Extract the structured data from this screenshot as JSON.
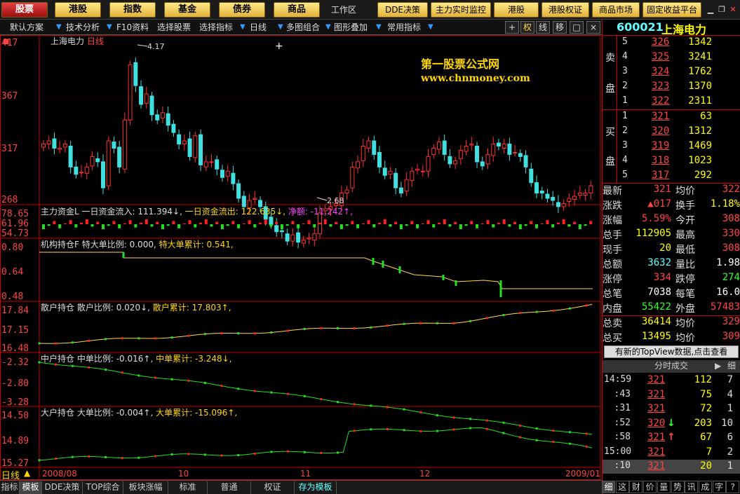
{
  "nav": {
    "main": [
      "股票",
      "港股",
      "指数",
      "基金",
      "债券",
      "商品"
    ],
    "workspace": "工作区",
    "secondary": [
      "DDE决策",
      "主力实时监控",
      "港股",
      "港股权证",
      "商品市场",
      "固定收益平台"
    ]
  },
  "toolbar": {
    "items": [
      "默认方案",
      "技术分析",
      "F10资料",
      "选择股票",
      "选择指标",
      "日线",
      "多图组合",
      "图形叠加",
      "常用指标"
    ],
    "buttons": [
      "+",
      "权",
      "线",
      "移",
      "□",
      "×"
    ]
  },
  "stock": {
    "code": "600021",
    "name": "上海电力"
  },
  "panes": {
    "main": {
      "title": "上海电力",
      "period": "日线",
      "y_labels": [
        "417",
        "367",
        "317",
        "268"
      ],
      "high": "4.17",
      "low": "2.68"
    },
    "watermark": {
      "line1": "第一股票公式网",
      "line2": "www.chnmoney.com"
    },
    "fund": {
      "label": "主力资金L",
      "inflow_label": "一日资金流入:",
      "inflow": "111.394",
      "outflow_label": "一日资金流出:",
      "outflow": "122.635",
      "net_label": "净额:",
      "net": "-11.242",
      "y_labels": [
        "78.65",
        "61.96",
        "54.73"
      ]
    },
    "inst": {
      "label": "机构持仓F",
      "ratio_label": "特大单比例:",
      "ratio": "0.000,",
      "cum_label": "特大单累计:",
      "cum": "0.541,",
      "y_labels": [
        "0.80",
        "0.64",
        "0.48"
      ]
    },
    "retail": {
      "label": "散户持仓",
      "ratio_label": "散户比例:",
      "ratio": "0.020",
      "cum_label": "散户累计:",
      "cum": "17.803",
      "y_labels": [
        "17.84",
        "17.15",
        "16.48"
      ]
    },
    "mid": {
      "label": "中户持仓",
      "ratio_label": "中单比例:",
      "ratio": "-0.016",
      "cum_label": "中单累计:",
      "cum": "-3.248",
      "y_labels": [
        "-2.32",
        "-2.80",
        "-3.28"
      ]
    },
    "big": {
      "label": "大户持仓",
      "ratio_label": "大单比例:",
      "ratio": "-0.004",
      "cum_label": "大单累计:",
      "cum": "-15.096",
      "y_labels": [
        "14.50",
        "14.89",
        "15.27"
      ]
    },
    "xaxis": {
      "period": "日线",
      "ticks": [
        "2008/08",
        "10",
        "11",
        "12",
        "2009/01"
      ]
    }
  },
  "orderbook": {
    "sell_label": [
      "卖",
      "盘"
    ],
    "buy_label": [
      "买",
      "盘"
    ],
    "sell": [
      {
        "lvl": "5",
        "price": "326",
        "vol": "1342"
      },
      {
        "lvl": "4",
        "price": "325",
        "vol": "3241"
      },
      {
        "lvl": "3",
        "price": "324",
        "vol": "1762"
      },
      {
        "lvl": "2",
        "price": "323",
        "vol": "1370"
      },
      {
        "lvl": "1",
        "price": "322",
        "vol": "2311"
      }
    ],
    "buy": [
      {
        "lvl": "1",
        "price": "321",
        "vol": "63"
      },
      {
        "lvl": "2",
        "price": "320",
        "vol": "1312"
      },
      {
        "lvl": "3",
        "price": "319",
        "vol": "1469"
      },
      {
        "lvl": "4",
        "price": "318",
        "vol": "1023"
      },
      {
        "lvl": "5",
        "price": "317",
        "vol": "292"
      }
    ]
  },
  "quote": [
    {
      "k1": "最新",
      "v1": "321",
      "c1": "#ff4444",
      "k2": "均价",
      "v2": "322",
      "c2": "#ff4444"
    },
    {
      "k1": "涨跌",
      "v1": "▲017",
      "c1": "#ff4444",
      "k2": "换手",
      "v2": "1.18%",
      "c2": "#ffff00"
    },
    {
      "k1": "涨幅",
      "v1": "5.59%",
      "c1": "#ff4444",
      "k2": "今开",
      "v2": "308",
      "c2": "#ff4444"
    },
    {
      "k1": "总手",
      "v1": "112905",
      "c1": "#ffff00",
      "k2": "最高",
      "v2": "330",
      "c2": "#ff4444"
    },
    {
      "k1": "现手",
      "v1": "20",
      "c1": "#ffff00",
      "k2": "最低",
      "v2": "308",
      "c2": "#ff4444"
    },
    {
      "k1": "总额",
      "v1": "3632",
      "c1": "#66ffff",
      "k2": "量比",
      "v2": "1.98",
      "c2": "#ffffff"
    },
    {
      "k1": "涨停",
      "v1": "334",
      "c1": "#ff4444",
      "k2": "跌停",
      "v2": "274",
      "c2": "#33ff33"
    },
    {
      "k1": "总笔",
      "v1": "7038",
      "c1": "#ffffff",
      "k2": "每笔",
      "v2": "16.0",
      "c2": "#ffffff"
    },
    {
      "k1": "内盘",
      "v1": "55422",
      "c1": "#33ff33",
      "k2": "外盘",
      "v2": "57483",
      "c2": "#ff4444"
    },
    {
      "k1": "总卖",
      "v1": "36414",
      "c1": "#ffff00",
      "k2": "均价",
      "v2": "329",
      "c2": "#ff4444"
    },
    {
      "k1": "总买",
      "v1": "13495",
      "c1": "#ffff00",
      "k2": "均价",
      "v2": "309",
      "c2": "#ff4444"
    }
  ],
  "topview": "有新的TopView数据,点击查看",
  "ticks_header": "分时成交",
  "ticks_detail": "细",
  "ticks": [
    {
      "t": "14:59",
      "p": "321",
      "v": "112",
      "n": "7",
      "arrow": ""
    },
    {
      "t": ":43",
      "p": "321",
      "v": "75",
      "n": "4",
      "arrow": ""
    },
    {
      "t": ":31",
      "p": "321",
      "v": "72",
      "n": "1",
      "arrow": ""
    },
    {
      "t": ":52",
      "p": "320",
      "v": "203",
      "n": "10",
      "arrow": "↓"
    },
    {
      "t": ":58",
      "p": "321",
      "v": "67",
      "n": "6",
      "arrow": "↑"
    },
    {
      "t": "15:00",
      "p": "321",
      "v": "7",
      "n": "2",
      "arrow": ""
    },
    {
      "t": ":10",
      "p": "321",
      "v": "20",
      "n": "1",
      "arrow": ""
    }
  ],
  "bottom_tabs": [
    "指标",
    "模板",
    "DDE决策",
    "TOP综合",
    "板块涨幅",
    "标准",
    "普通",
    "权证",
    "存为模板"
  ],
  "right_tabs": [
    "细",
    "这",
    "财",
    "价",
    "量",
    "势",
    "讯",
    "成",
    "字",
    "?"
  ]
}
